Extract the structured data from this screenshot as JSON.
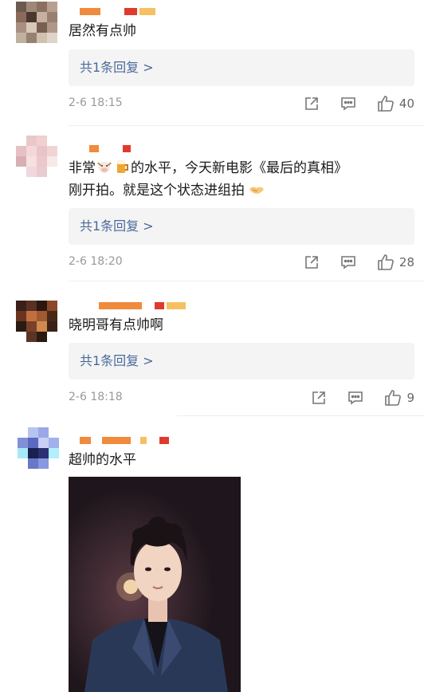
{
  "comments": [
    {
      "text_lines": [
        "居然有点帅"
      ],
      "reply_label": "共1条回复 >",
      "time": "2-6 18:15",
      "likes": "40"
    },
    {
      "text_lines": [
        "非常",
        "的水平，今天新电影《最后的真相》",
        "刚开拍。就是这个状态进组拍"
      ],
      "reply_label": "共1条回复 >",
      "time": "2-6 18:20",
      "likes": "28"
    },
    {
      "text_lines": [
        "晓明哥有点帅啊"
      ],
      "reply_label": "共1条回复 >",
      "time": "2-6 18:18",
      "likes": "9"
    },
    {
      "text_lines": [
        "超帅的水平"
      ]
    }
  ],
  "icons": {
    "share": "share-icon",
    "comment": "comment-icon",
    "like": "thumbs-up-icon",
    "emoji_ox": "ox-face-emoji-icon",
    "emoji_beer": "beer-mug-emoji-icon",
    "emoji_handshake": "handshake-emoji-icon"
  },
  "colors": {
    "reply_text": "#4a6a9a",
    "meta_text": "#999999",
    "reply_bg": "#f4f4f4"
  }
}
